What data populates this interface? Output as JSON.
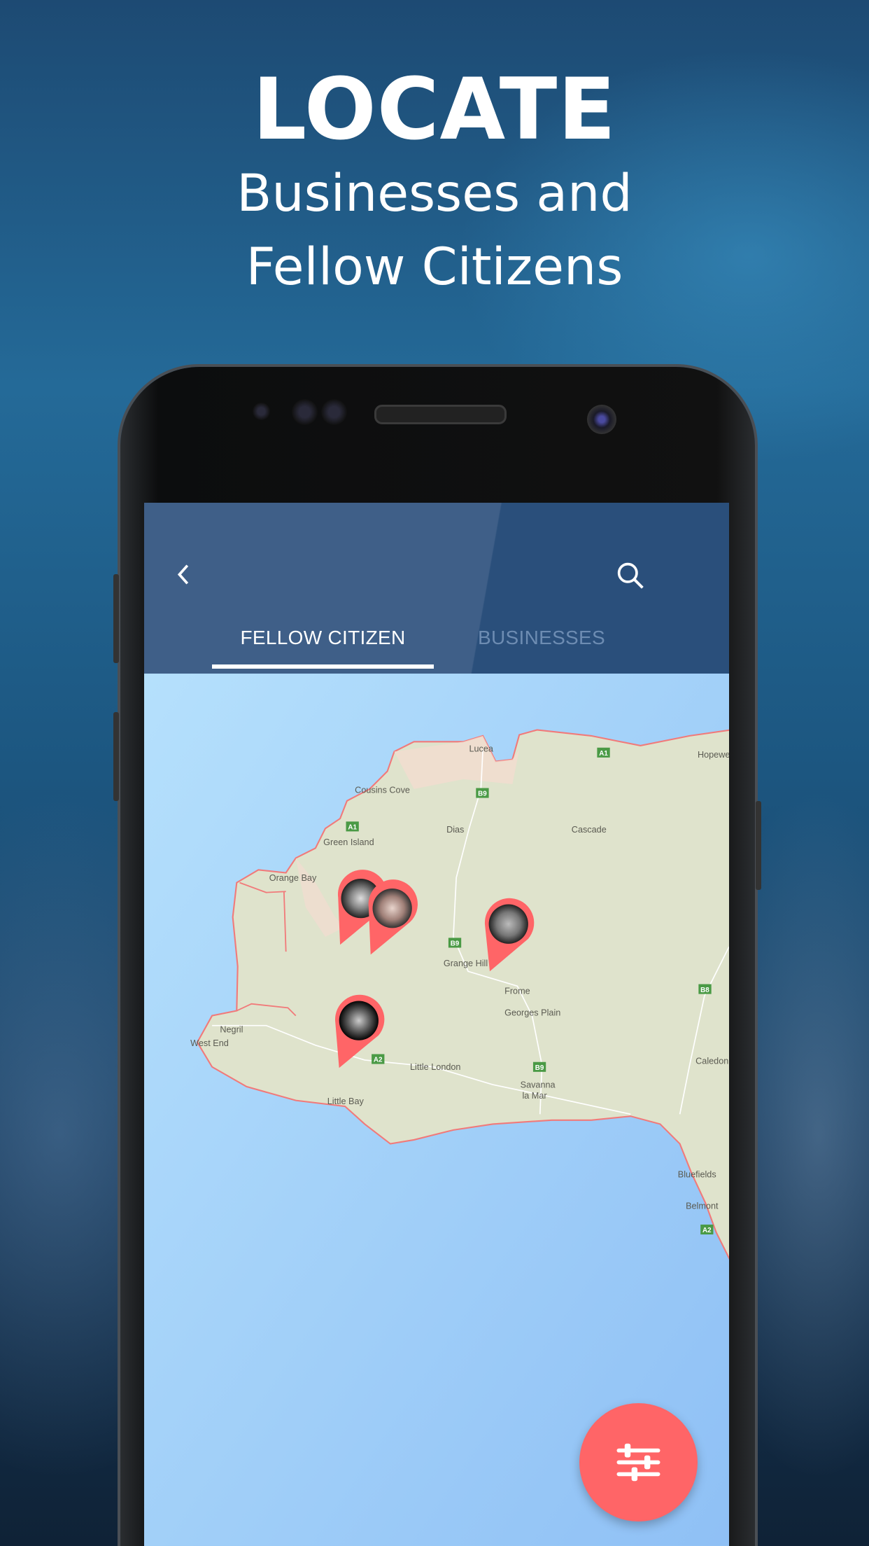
{
  "promo": {
    "title": "LOCATE",
    "subtitle_line1": "Businesses and",
    "subtitle_line2": "Fellow Citizens"
  },
  "app_bar": {
    "back_icon": "chevron-left-icon",
    "search_icon": "search-icon",
    "tabs": [
      {
        "label": "FELLOW CITIZEN",
        "active": true
      },
      {
        "label": "BUSINESSES",
        "active": false
      }
    ]
  },
  "map": {
    "places": [
      "Lucea",
      "Hopewell",
      "Cousins Cove",
      "Dias",
      "Cascade",
      "Green Island",
      "Orange Bay",
      "Grange Hill",
      "Frome",
      "Georges Plain",
      "Negril",
      "West End",
      "Little London",
      "Savanna",
      "la Mar",
      "Little Bay",
      "Caledonia",
      "Bluefields",
      "Belmont"
    ],
    "road_shields": [
      "A1",
      "B9",
      "A1",
      "B9",
      "B8",
      "A2",
      "B9",
      "A2"
    ],
    "markers_count": 4
  },
  "fab": {
    "icon": "filter-sliders-icon"
  },
  "colors": {
    "app_bar": "#2a4f7b",
    "accent": "#ff6567",
    "tab_inactive": "#6d8cb2",
    "land": "#dfe3cc",
    "water": "#9cc9f2"
  }
}
